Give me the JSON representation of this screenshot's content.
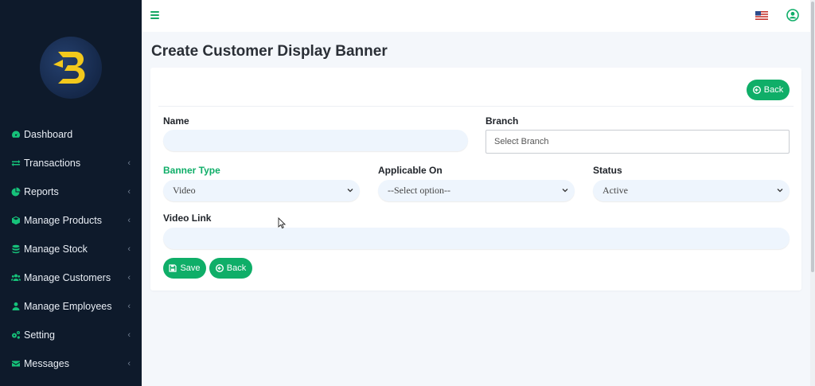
{
  "sidebar": {
    "items": [
      {
        "label": "Dashboard",
        "icon": "dashboard-icon",
        "has_submenu": false
      },
      {
        "label": "Transactions",
        "icon": "exchange-icon",
        "has_submenu": true
      },
      {
        "label": "Reports",
        "icon": "pie-chart-icon",
        "has_submenu": true
      },
      {
        "label": "Manage Products",
        "icon": "cube-icon",
        "has_submenu": true
      },
      {
        "label": "Manage Stock",
        "icon": "database-icon",
        "has_submenu": true
      },
      {
        "label": "Manage Customers",
        "icon": "users-icon",
        "has_submenu": true
      },
      {
        "label": "Manage Employees",
        "icon": "user-icon",
        "has_submenu": true
      },
      {
        "label": "Setting",
        "icon": "cogs-icon",
        "has_submenu": true
      },
      {
        "label": "Messages",
        "icon": "envelope-icon",
        "has_submenu": true
      }
    ],
    "chevron": "‹"
  },
  "header": {
    "menu_icon": "hamburger-icon",
    "language_icon": "us-flag-icon",
    "profile_icon": "user-circle-icon"
  },
  "page": {
    "title": "Create Customer Display Banner"
  },
  "form": {
    "back_top_label": "Back",
    "name_label": "Name",
    "name_value": "",
    "branch_label": "Branch",
    "branch_placeholder": "Select Branch",
    "banner_type_label": "Banner Type",
    "banner_type_value": "Video",
    "applicable_on_label": "Applicable On",
    "applicable_on_value": "--Select option--",
    "status_label": "Status",
    "status_value": "Active",
    "video_link_label": "Video Link",
    "video_link_value": "",
    "save_label": "Save",
    "back_bottom_label": "Back"
  },
  "colors": {
    "sidebar_bg": "#0e1a2b",
    "accent": "#0fae68",
    "page_bg": "#f4f7fb"
  }
}
